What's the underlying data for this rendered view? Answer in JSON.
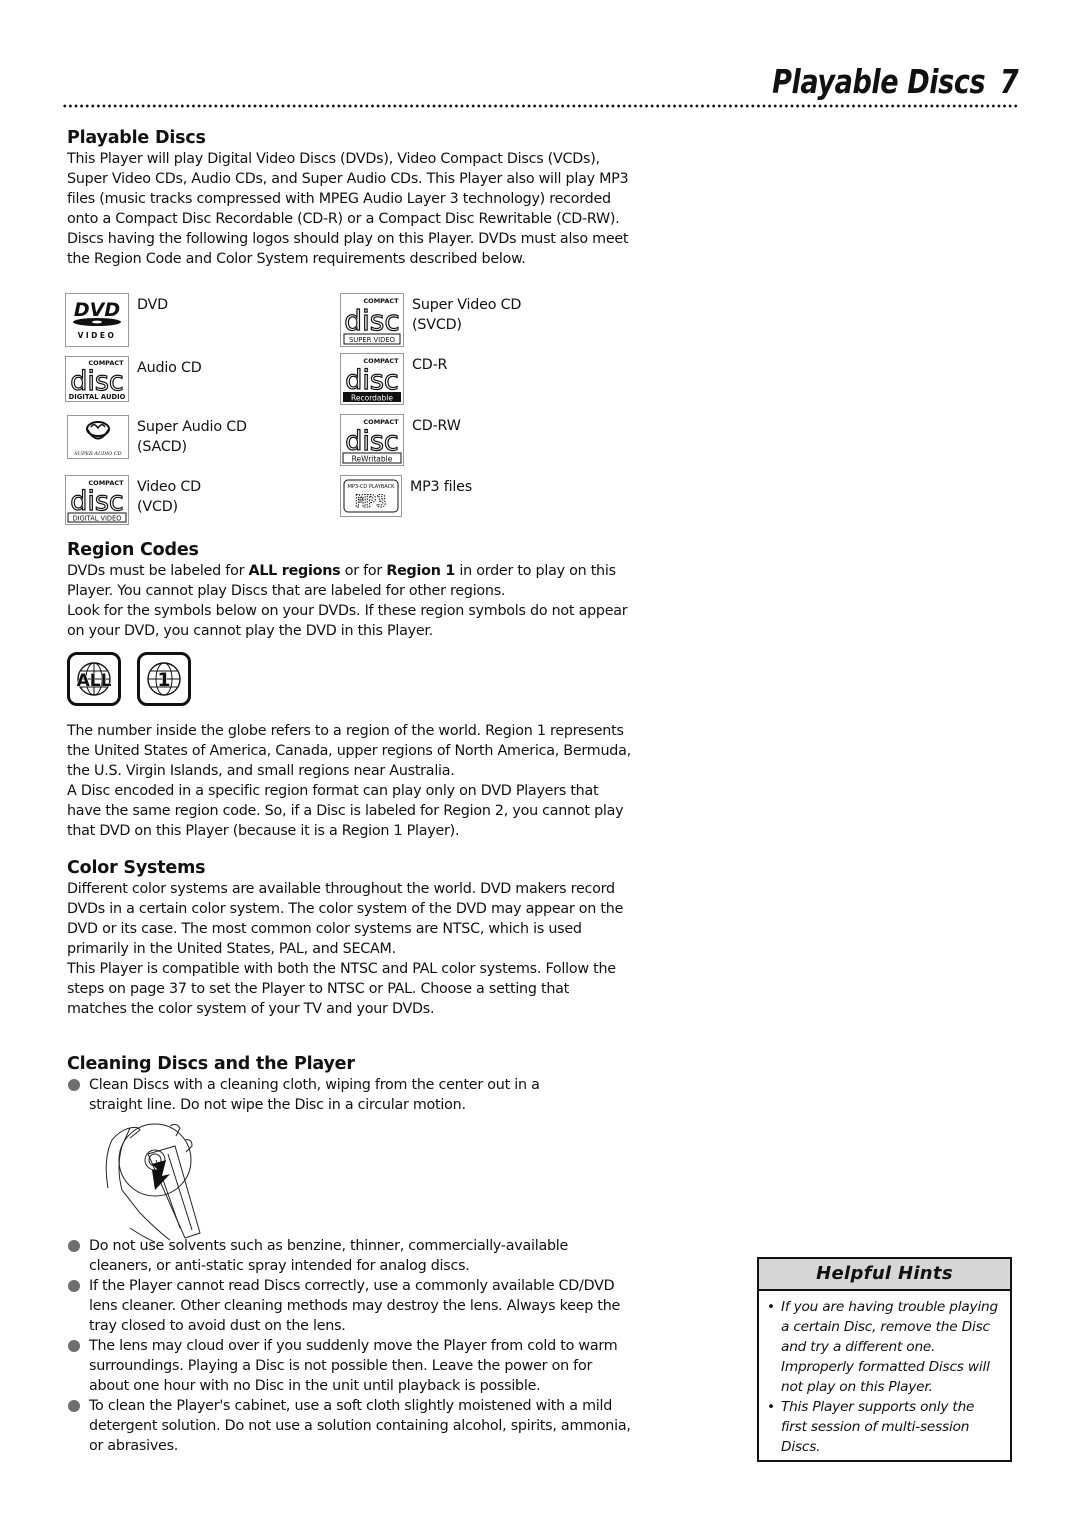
{
  "header": {
    "title": "Playable Discs",
    "page_number": "7"
  },
  "sections": {
    "playable": {
      "heading": "Playable Discs",
      "paragraphs": [
        "This Player will play Digital Video Discs (DVDs), Video Compact Discs (VCDs), Super Video CDs, Audio CDs, and Super Audio CDs. This Player also will play MP3 files (music tracks compressed with MPEG Audio Layer 3 technology) recorded onto a Compact Disc Recordable (CD-R) or a Compact Disc Rewritable (CD-RW).",
        "Discs having the following logos should play on this Player. DVDs must also meet the Region Code and Color System requirements described below."
      ],
      "logos": [
        {
          "icon": "dvd-video-logo",
          "label": "DVD",
          "logo_text": [
            "DVD",
            "VIDEO"
          ]
        },
        {
          "icon": "super-video-cd-logo",
          "label": "Super Video CD (SVCD)",
          "logo_text": [
            "COMPACT",
            "disc",
            "SUPER VIDEO"
          ]
        },
        {
          "icon": "audio-cd-logo",
          "label": "Audio CD",
          "logo_text": [
            "COMPACT",
            "disc",
            "DIGITAL AUDIO"
          ]
        },
        {
          "icon": "cd-r-logo",
          "label": "CD-R",
          "logo_text": [
            "COMPACT",
            "disc",
            "Recordable"
          ]
        },
        {
          "icon": "sacd-logo",
          "label": "Super Audio CD (SACD)",
          "logo_text": [
            "SUPER AUDIO CD"
          ]
        },
        {
          "icon": "cd-rw-logo",
          "label": "CD-RW",
          "logo_text": [
            "COMPACT",
            "disc",
            "ReWritable"
          ]
        },
        {
          "icon": "video-cd-logo",
          "label": "Video CD (VCD)",
          "logo_text": [
            "COMPACT",
            "disc",
            "DIGITAL VIDEO"
          ]
        },
        {
          "icon": "mp3-cd-logo",
          "label": "MP3 files",
          "logo_text": [
            "MP3-CD PLAYBACK",
            "MP3"
          ]
        }
      ]
    },
    "region": {
      "heading": "Region Codes",
      "intro_pre": "DVDs must be labeled for ",
      "intro_bold1": "ALL regions",
      "intro_mid": " or for ",
      "intro_bold2": "Region 1",
      "intro_post": " in order to play on this Player. You cannot play Discs that are labeled for other regions.",
      "paragraph2": "Look for the symbols below on your DVDs. If these region symbols do not appear on your DVD, you cannot play the DVD in this Player.",
      "symbols": [
        {
          "icon": "region-all-globe-icon",
          "text": "ALL"
        },
        {
          "icon": "region-1-globe-icon",
          "text": "1"
        }
      ],
      "paragraph3": "The number inside the globe refers to a region of the world. Region 1 represents the United States of America, Canada, upper regions of North America, Bermuda, the U.S. Virgin Islands, and small regions near Australia.",
      "paragraph4": "A Disc encoded in a specific region format can play only on DVD Players that have the same region code. So, if a Disc is labeled for Region 2, you cannot play that DVD on this Player (because it is a Region 1 Player)."
    },
    "color": {
      "heading": "Color Systems",
      "paragraphs": [
        "Different color systems are available throughout the world. DVD makers record DVDs in a certain color system. The color system of the DVD may appear on the DVD or its case. The most common color systems are NTSC, which is used primarily in the United States, PAL, and SECAM.",
        "This Player is compatible with both the NTSC and PAL color systems. Follow the steps on page 37 to set the Player to NTSC or PAL. Choose a setting that matches the color system of your TV and your DVDs."
      ]
    },
    "cleaning": {
      "heading": "Cleaning Discs and the Player",
      "bullets_top": [
        "Clean Discs with a cleaning cloth, wiping from the center out in a straight line. Do not wipe the Disc in a circular motion."
      ],
      "illustration": "disc-cleaning-illustration",
      "bullets_bottom": [
        "Do not use solvents such as benzine, thinner, commercially-available cleaners, or anti-static spray intended for analog discs.",
        "If the Player cannot read Discs correctly, use a commonly available CD/DVD lens cleaner. Other cleaning methods may destroy the lens. Always keep the tray closed to avoid dust on the lens.",
        "The lens may cloud over if you suddenly move the Player from cold to warm surroundings. Playing a Disc is not possible then. Leave the power on for about one hour with no Disc in the unit until playback is possible.",
        "To clean the Player's cabinet, use a soft cloth slightly moistened with a mild detergent solution. Do not use a solution containing alcohol, spirits, ammonia, or abrasives."
      ]
    }
  },
  "hints": {
    "title": "Helpful Hints",
    "bullet_glyph": "•",
    "items": [
      "If you are having trouble playing a certain Disc, remove the Disc and try a different one. Improperly formatted Discs will not play on this Player.",
      "This Player supports only the first session of multi-session Discs."
    ]
  },
  "colors": {
    "text": "#111111",
    "bullet": "#6e6e6e",
    "hints_header_bg": "#d6d6d6",
    "logo_border": "#999999"
  }
}
